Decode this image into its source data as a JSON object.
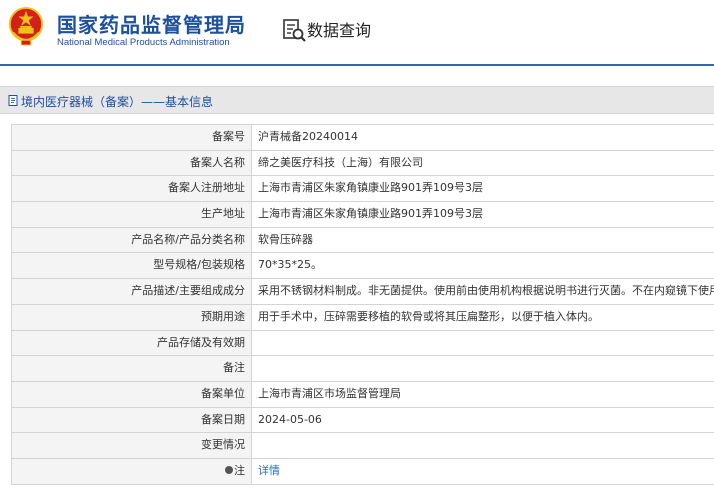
{
  "header": {
    "title_cn": "国家药品监督管理局",
    "title_en": "National Medical Products Administration",
    "query_label": "数据查询",
    "emblem_icon": "national-emblem",
    "query_icon": "search-document-icon"
  },
  "breadcrumb": {
    "text": "境内医疗器械（备案）——基本信息",
    "icon": "document-icon"
  },
  "details": [
    {
      "label": "备案号",
      "value": "沪青械备20240014"
    },
    {
      "label": "备案人名称",
      "value": "缔之美医疗科技（上海）有限公司"
    },
    {
      "label": "备案人注册地址",
      "value": "上海市青浦区朱家角镇康业路901弄109号3层"
    },
    {
      "label": "生产地址",
      "value": "上海市青浦区朱家角镇康业路901弄109号3层"
    },
    {
      "label": "产品名称/产品分类名称",
      "value": "软骨压碎器"
    },
    {
      "label": "型号规格/包装规格",
      "value": "70*35*25。"
    },
    {
      "label": "产品描述/主要组成成分",
      "value": "采用不锈钢材料制成。非无菌提供。使用前由使用机构根据说明书进行灭菌。不在内窥镜下使用。"
    },
    {
      "label": "预期用途",
      "value": "用于手术中，压碎需要移植的软骨或将其压扁整形，以便于植入体内。"
    },
    {
      "label": "产品存储及有效期",
      "value": ""
    },
    {
      "label": "备注",
      "value": ""
    },
    {
      "label": "备案单位",
      "value": "上海市青浦区市场监督管理局"
    },
    {
      "label": "备案日期",
      "value": "2024-05-06"
    },
    {
      "label": "变更情况",
      "value": ""
    },
    {
      "label": "注",
      "value": "详情"
    }
  ],
  "colors": {
    "brand_blue": "#1c4f9c",
    "link_blue": "#2a6ab8",
    "emblem_red": "#d4201b",
    "emblem_gold": "#f2c21a"
  }
}
